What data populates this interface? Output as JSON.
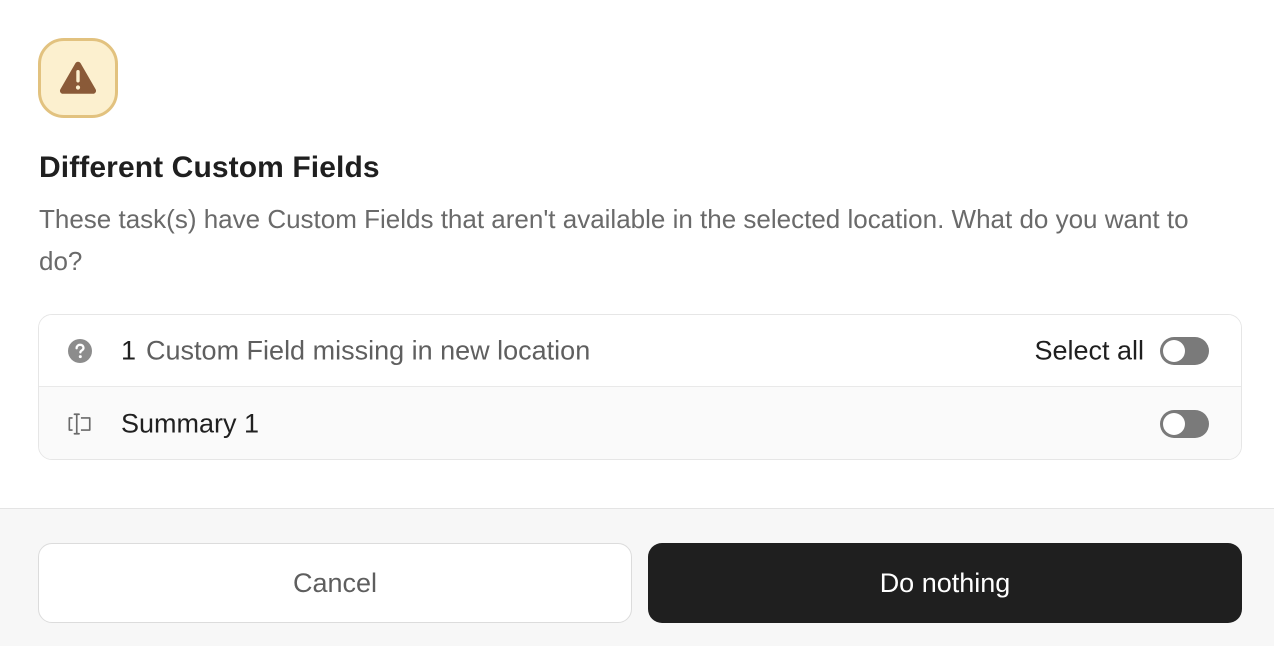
{
  "dialog": {
    "icon": "warning-triangle-icon",
    "title": "Different Custom Fields",
    "description": "These task(s) have Custom Fields that aren't available in the selected location. What do you want to do?"
  },
  "fields": {
    "header": {
      "icon": "question-circle-icon",
      "count": "1",
      "label": "Custom Field missing in new location",
      "select_all_label": "Select all",
      "select_all_on": false
    },
    "items": [
      {
        "icon": "text-field-icon",
        "label": "Summary 1",
        "enabled": false
      }
    ]
  },
  "footer": {
    "cancel_label": "Cancel",
    "primary_label": "Do nothing"
  },
  "colors": {
    "warning_bg": "#fcf0cf",
    "warning_border": "#e2c27f",
    "warning_icon": "#8a5a38",
    "primary_button": "#1f1f1f",
    "toggle_off": "#7a7a7a"
  }
}
